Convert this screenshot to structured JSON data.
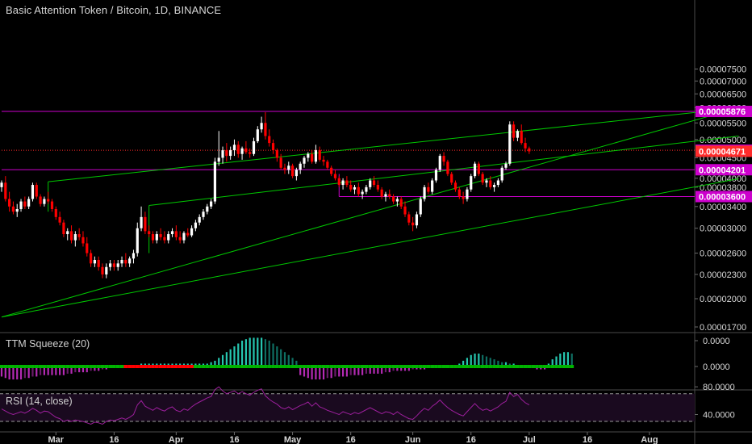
{
  "title": "Basic Attention Token / Bitcoin, 1D, BINANCE",
  "colors": {
    "background": "#000000",
    "up_candle": "#ffffff",
    "down_candle": "#ff0000",
    "channel_line": "#00c800",
    "level_line": "#cc00cc",
    "price_line": "#ff2b2b",
    "axis_text": "#d8d8d8",
    "squeeze_bright_up": "#26c6b0",
    "squeeze_dark_up": "#0f6f63",
    "squeeze_bright_down": "#b42ab4",
    "squeeze_dark_down": "#6a1a6a",
    "squeeze_on": "#ff0000",
    "squeeze_off": "#00b400",
    "rsi_line": "#9c1f9c",
    "rsi_band": "#1a0a1f"
  },
  "chart_data": [
    {
      "type": "candlestick",
      "pane": "price",
      "y_ticks": [
        "0.00007500",
        "0.00007000",
        "0.00006500",
        "0.00006000",
        "0.00005500",
        "0.00005000",
        "0.00004500",
        "0.00004000",
        "0.00003800",
        "0.00003400",
        "0.00003000",
        "0.00002600",
        "0.00002300",
        "0.00002000",
        "0.00001700"
      ],
      "y_tick_values": [
        7.5,
        7.0,
        6.5,
        6.0,
        5.5,
        5.0,
        4.5,
        4.0,
        3.8,
        3.4,
        3.0,
        2.6,
        2.3,
        2.0,
        1.7
      ],
      "value_unit": "1e-5 BTC",
      "log_scale": true,
      "x_labels": [
        "Mar",
        "16",
        "Apr",
        "16",
        "May",
        "16",
        "Jun",
        "16",
        "Jul",
        "16",
        "Aug"
      ],
      "x_label_dates": [
        "2018-03-01",
        "2018-03-16",
        "2018-04-01",
        "2018-04-16",
        "2018-05-01",
        "2018-05-16",
        "2018-06-01",
        "2018-06-16",
        "2018-07-01",
        "2018-07-16",
        "2018-08-01"
      ],
      "first_candle_date": "2018-02-15",
      "candles": [
        [
          3.8,
          3.95,
          3.7,
          3.9
        ],
        [
          3.9,
          4.05,
          3.5,
          3.55
        ],
        [
          3.55,
          3.7,
          3.3,
          3.4
        ],
        [
          3.4,
          3.5,
          3.25,
          3.3
        ],
        [
          3.3,
          3.45,
          3.2,
          3.35
        ],
        [
          3.35,
          3.55,
          3.3,
          3.5
        ],
        [
          3.5,
          3.6,
          3.35,
          3.4
        ],
        [
          3.4,
          3.6,
          3.35,
          3.55
        ],
        [
          3.55,
          3.9,
          3.5,
          3.85
        ],
        [
          3.85,
          3.9,
          3.55,
          3.6
        ],
        [
          3.6,
          3.65,
          3.4,
          3.45
        ],
        [
          3.45,
          3.6,
          3.4,
          3.55
        ],
        [
          3.55,
          3.7,
          3.45,
          3.5
        ],
        [
          3.5,
          3.55,
          3.3,
          3.35
        ],
        [
          3.35,
          3.4,
          3.15,
          3.2
        ],
        [
          3.2,
          3.3,
          3.05,
          3.1
        ],
        [
          3.1,
          3.15,
          2.85,
          2.9
        ],
        [
          2.9,
          3.0,
          2.8,
          2.95
        ],
        [
          2.95,
          3.05,
          2.75,
          2.8
        ],
        [
          2.8,
          2.95,
          2.7,
          2.9
        ],
        [
          2.9,
          3.0,
          2.8,
          2.85
        ],
        [
          2.85,
          2.95,
          2.7,
          2.75
        ],
        [
          2.75,
          2.85,
          2.55,
          2.6
        ],
        [
          2.6,
          2.65,
          2.4,
          2.45
        ],
        [
          2.45,
          2.55,
          2.4,
          2.5
        ],
        [
          2.5,
          2.55,
          2.35,
          2.4
        ],
        [
          2.4,
          2.45,
          2.25,
          2.3
        ],
        [
          2.3,
          2.45,
          2.25,
          2.4
        ],
        [
          2.4,
          2.5,
          2.35,
          2.45
        ],
        [
          2.45,
          2.5,
          2.35,
          2.4
        ],
        [
          2.4,
          2.5,
          2.35,
          2.45
        ],
        [
          2.45,
          2.55,
          2.4,
          2.5
        ],
        [
          2.5,
          2.6,
          2.4,
          2.45
        ],
        [
          2.45,
          2.55,
          2.4,
          2.52
        ],
        [
          2.52,
          2.65,
          2.45,
          2.6
        ],
        [
          2.6,
          3.1,
          2.55,
          3.0
        ],
        [
          3.0,
          3.4,
          2.95,
          3.2
        ],
        [
          3.2,
          3.3,
          2.9,
          2.95
        ],
        [
          2.95,
          3.05,
          2.85,
          2.9
        ],
        [
          2.9,
          2.95,
          2.75,
          2.8
        ],
        [
          2.8,
          2.95,
          2.75,
          2.9
        ],
        [
          2.9,
          3.0,
          2.8,
          2.85
        ],
        [
          2.85,
          2.95,
          2.75,
          2.8
        ],
        [
          2.8,
          2.95,
          2.75,
          2.9
        ],
        [
          2.9,
          3.0,
          2.85,
          2.95
        ],
        [
          2.95,
          3.05,
          2.8,
          2.85
        ],
        [
          2.85,
          2.95,
          2.75,
          2.8
        ],
        [
          2.8,
          2.95,
          2.75,
          2.92
        ],
        [
          2.92,
          3.0,
          2.85,
          2.88
        ],
        [
          2.88,
          3.05,
          2.85,
          3.0
        ],
        [
          3.0,
          3.15,
          2.95,
          3.1
        ],
        [
          3.1,
          3.25,
          3.05,
          3.2
        ],
        [
          3.2,
          3.35,
          3.15,
          3.3
        ],
        [
          3.3,
          3.45,
          3.25,
          3.4
        ],
        [
          3.4,
          3.55,
          3.35,
          3.5
        ],
        [
          3.5,
          4.5,
          3.45,
          4.4
        ],
        [
          4.4,
          5.25,
          4.3,
          4.5
        ],
        [
          4.5,
          4.8,
          4.35,
          4.7
        ],
        [
          4.7,
          4.9,
          4.4,
          4.55
        ],
        [
          4.55,
          4.8,
          4.45,
          4.7
        ],
        [
          4.7,
          5.0,
          4.55,
          4.85
        ],
        [
          4.85,
          4.95,
          4.5,
          4.6
        ],
        [
          4.6,
          4.8,
          4.45,
          4.75
        ],
        [
          4.75,
          4.95,
          4.6,
          4.65
        ],
        [
          4.65,
          4.75,
          4.5,
          4.6
        ],
        [
          4.6,
          5.05,
          4.55,
          4.95
        ],
        [
          4.95,
          5.4,
          4.9,
          5.3
        ],
        [
          5.3,
          5.7,
          5.2,
          5.5
        ],
        [
          5.5,
          5.85,
          5.0,
          5.1
        ],
        [
          5.1,
          5.3,
          4.8,
          4.9
        ],
        [
          4.9,
          5.0,
          4.6,
          4.7
        ],
        [
          4.7,
          4.75,
          4.4,
          4.5
        ],
        [
          4.5,
          4.6,
          4.2,
          4.25
        ],
        [
          4.25,
          4.35,
          4.1,
          4.2
        ],
        [
          4.2,
          4.4,
          4.1,
          4.3
        ],
        [
          4.3,
          4.35,
          4.0,
          4.05
        ],
        [
          4.05,
          4.25,
          3.95,
          4.2
        ],
        [
          4.2,
          4.4,
          4.1,
          4.35
        ],
        [
          4.35,
          4.55,
          4.25,
          4.5
        ],
        [
          4.5,
          4.65,
          4.4,
          4.6
        ],
        [
          4.6,
          4.7,
          4.35,
          4.4
        ],
        [
          4.4,
          4.85,
          4.35,
          4.7
        ],
        [
          4.7,
          4.8,
          4.4,
          4.45
        ],
        [
          4.45,
          4.55,
          4.3,
          4.4
        ],
        [
          4.4,
          4.45,
          4.2,
          4.25
        ],
        [
          4.25,
          4.3,
          4.05,
          4.1
        ],
        [
          4.1,
          4.2,
          3.95,
          4.0
        ],
        [
          4.0,
          4.05,
          3.8,
          3.85
        ],
        [
          3.85,
          4.0,
          3.75,
          3.95
        ],
        [
          3.95,
          4.05,
          3.8,
          3.85
        ],
        [
          3.85,
          3.95,
          3.7,
          3.75
        ],
        [
          3.75,
          3.85,
          3.65,
          3.8
        ],
        [
          3.8,
          3.9,
          3.6,
          3.65
        ],
        [
          3.65,
          3.75,
          3.55,
          3.7
        ],
        [
          3.7,
          3.85,
          3.65,
          3.8
        ],
        [
          3.8,
          4.0,
          3.75,
          3.95
        ],
        [
          3.95,
          4.05,
          3.8,
          3.85
        ],
        [
          3.85,
          3.95,
          3.7,
          3.75
        ],
        [
          3.75,
          3.8,
          3.55,
          3.6
        ],
        [
          3.6,
          3.7,
          3.5,
          3.65
        ],
        [
          3.65,
          3.75,
          3.55,
          3.6
        ],
        [
          3.6,
          3.65,
          3.45,
          3.5
        ],
        [
          3.5,
          3.6,
          3.4,
          3.55
        ],
        [
          3.55,
          3.6,
          3.35,
          3.4
        ],
        [
          3.4,
          3.5,
          3.2,
          3.25
        ],
        [
          3.25,
          3.3,
          3.05,
          3.1
        ],
        [
          3.1,
          3.2,
          2.95,
          3.05
        ],
        [
          3.05,
          3.3,
          3.0,
          3.25
        ],
        [
          3.25,
          3.6,
          3.2,
          3.55
        ],
        [
          3.55,
          3.85,
          3.5,
          3.8
        ],
        [
          3.8,
          3.9,
          3.65,
          3.7
        ],
        [
          3.7,
          4.0,
          3.65,
          3.95
        ],
        [
          3.95,
          4.25,
          3.9,
          4.2
        ],
        [
          4.2,
          4.6,
          4.15,
          4.55
        ],
        [
          4.55,
          4.65,
          4.3,
          4.4
        ],
        [
          4.4,
          4.45,
          4.05,
          4.1
        ],
        [
          4.1,
          4.15,
          3.85,
          3.9
        ],
        [
          3.9,
          3.95,
          3.7,
          3.75
        ],
        [
          3.75,
          3.8,
          3.55,
          3.6
        ],
        [
          3.6,
          3.7,
          3.45,
          3.55
        ],
        [
          3.55,
          3.8,
          3.5,
          3.75
        ],
        [
          3.75,
          4.1,
          3.7,
          4.05
        ],
        [
          4.05,
          4.4,
          4.0,
          4.35
        ],
        [
          4.35,
          4.4,
          4.05,
          4.1
        ],
        [
          4.1,
          4.15,
          3.85,
          3.9
        ],
        [
          3.9,
          4.0,
          3.8,
          3.95
        ],
        [
          3.95,
          4.05,
          3.75,
          3.8
        ],
        [
          3.8,
          3.9,
          3.7,
          3.85
        ],
        [
          3.85,
          4.0,
          3.8,
          3.95
        ],
        [
          3.95,
          4.3,
          3.9,
          4.25
        ],
        [
          4.25,
          4.4,
          4.2,
          4.35
        ],
        [
          4.35,
          5.55,
          4.3,
          5.45
        ],
        [
          5.45,
          5.55,
          4.95,
          5.05
        ],
        [
          5.05,
          5.3,
          4.95,
          5.25
        ],
        [
          5.25,
          5.45,
          4.85,
          4.9
        ],
        [
          4.9,
          5.05,
          4.65,
          4.75
        ],
        [
          4.75,
          4.8,
          4.6,
          4.67
        ]
      ],
      "markers": [
        {
          "label": "0.00005876",
          "value": 5.876,
          "style": "level"
        },
        {
          "label": "0.00004700",
          "value": 4.7,
          "style": "level"
        },
        {
          "label": "0.00004671",
          "value": 4.671,
          "style": "last_price"
        },
        {
          "label": "0.00004201",
          "value": 4.201,
          "style": "level"
        },
        {
          "label": "0.00003600",
          "value": 3.6,
          "style": "level"
        }
      ],
      "horizontal_levels": [
        {
          "value": 5.876,
          "from_index": 0
        },
        {
          "value": 4.201,
          "from_index": 0
        },
        {
          "value": 3.6,
          "from_index": 87
        },
        {
          "value": 4.7,
          "from_index": 0,
          "style": "dotted"
        }
      ],
      "channel_lines": [
        {
          "a": [
            0,
            1.8
          ],
          "b": [
            190,
            6.0
          ]
        },
        {
          "a": [
            12,
            3.92
          ],
          "b": [
            190,
            6.0
          ]
        },
        {
          "a": [
            38,
            3.42
          ],
          "b": [
            190,
            5.1
          ]
        },
        {
          "a": [
            0,
            1.8
          ],
          "b": [
            190,
            3.99
          ]
        }
      ],
      "connector_lines": [
        {
          "a": [
            12,
            3.92
          ],
          "b": [
            12,
            3.3
          ]
        },
        {
          "a": [
            38,
            3.42
          ],
          "b": [
            38,
            2.6
          ]
        },
        {
          "a": [
            87,
            3.6
          ],
          "b": [
            87,
            4.1
          ]
        }
      ]
    },
    {
      "type": "histogram",
      "pane": "ttm_squeeze",
      "label": "TTM Squeeze (20)",
      "y_ticks": [
        "0.0000",
        "0.0000"
      ],
      "values": [
        -7,
        -8,
        -9,
        -9,
        -9,
        -9,
        -8,
        -8,
        -7,
        -7,
        -6,
        -6,
        -6,
        -6,
        -6,
        -6,
        -6,
        -5,
        -5,
        -4,
        -4,
        -4,
        -4,
        -3,
        -3,
        -3,
        -2,
        -2,
        -1,
        -1,
        0,
        1,
        1,
        1,
        1,
        1,
        2,
        2,
        2,
        2,
        2,
        2,
        2,
        2,
        2,
        2,
        2,
        2,
        2,
        2,
        2,
        2,
        2,
        2,
        3,
        4,
        6,
        8,
        10,
        12,
        14,
        16,
        18,
        19,
        20,
        20,
        20,
        20,
        19,
        18,
        16,
        14,
        12,
        10,
        8,
        6,
        4,
        -6,
        -7,
        -8,
        -9,
        -9,
        -9,
        -9,
        -8,
        -8,
        -7,
        -7,
        -7,
        -7,
        -6,
        -6,
        -6,
        -6,
        -5,
        -5,
        -5,
        -5,
        -5,
        -4,
        -4,
        -3,
        -3,
        -3,
        -3,
        -3,
        -2,
        -2,
        -2,
        -2,
        -1,
        -1,
        -1,
        -1,
        -1,
        -1,
        -1,
        0,
        2,
        4,
        6,
        8,
        9,
        9,
        8,
        7,
        6,
        5,
        4,
        3,
        3,
        2,
        2,
        1,
        1,
        0,
        -1,
        -1,
        -2,
        -2,
        -2,
        2,
        5,
        7,
        9,
        10,
        10,
        9
      ],
      "squeeze_on_range": [
        32,
        49
      ]
    },
    {
      "type": "line",
      "pane": "rsi",
      "label": "RSI (14, close)",
      "y_ticks": [
        "80.0000",
        "40.0000"
      ],
      "y_tick_values": [
        80,
        40
      ],
      "band_top": 70,
      "band_bottom": 30,
      "values": [
        48,
        45,
        42,
        40,
        42,
        44,
        42,
        45,
        49,
        46,
        42,
        45,
        44,
        40,
        36,
        34,
        30,
        32,
        30,
        32,
        31,
        30,
        28,
        26,
        29,
        28,
        26,
        30,
        32,
        31,
        33,
        35,
        33,
        36,
        40,
        54,
        60,
        52,
        49,
        46,
        50,
        47,
        45,
        49,
        51,
        46,
        44,
        48,
        46,
        51,
        55,
        58,
        61,
        64,
        66,
        76,
        80,
        74,
        70,
        72,
        74,
        70,
        73,
        70,
        68,
        72,
        75,
        77,
        67,
        62,
        58,
        55,
        50,
        48,
        51,
        47,
        50,
        53,
        55,
        58,
        52,
        57,
        51,
        49,
        46,
        44,
        42,
        40,
        44,
        42,
        40,
        43,
        41,
        44,
        47,
        50,
        47,
        44,
        41,
        44,
        43,
        40,
        44,
        40,
        37,
        34,
        33,
        38,
        44,
        49,
        46,
        52,
        56,
        61,
        55,
        50,
        46,
        43,
        40,
        38,
        44,
        50,
        56,
        50,
        46,
        48,
        45,
        48,
        51,
        56,
        59,
        72,
        66,
        69,
        62,
        57,
        54
      ]
    }
  ]
}
